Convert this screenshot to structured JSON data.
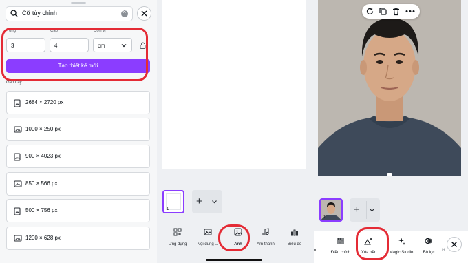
{
  "left_panel": {
    "search": {
      "value": "Cỡ tùy chỉnh"
    },
    "width_label": "rộng",
    "height_label": "Cao",
    "unit_label": "Đơn vị",
    "width_value": "3",
    "height_value": "4",
    "unit_value": "cm",
    "create_button": "Tạo thiết kế mới",
    "recent_label": "Gần đây",
    "recent_sizes": [
      "2684 × 2720 px",
      "1000 × 250 px",
      "900 × 4023 px",
      "850 × 566 px",
      "500 × 756 px",
      "1200 × 628 px"
    ]
  },
  "middle_panel": {
    "page_number": "1",
    "toolbar": [
      "Ứng dụng",
      "Nội dung ...",
      "Ảnh",
      "Âm thanh",
      "Biểu đồ"
    ]
  },
  "right_panel": {
    "page_number": "1",
    "toolbar": [
      "n",
      "Điều chỉnh",
      "Xóa nền",
      "Magic Studio",
      "Bộ lọc",
      "H"
    ]
  },
  "colors": {
    "accent": "#8b3dff",
    "highlight_ring": "#e42b35"
  },
  "icons": [
    "search-icon",
    "clear-icon",
    "close-icon",
    "chevron-down-icon",
    "lock-icon",
    "portrait-size-icon",
    "landscape-size-icon",
    "apps-icon",
    "content-icon",
    "photo-icon",
    "music-icon",
    "chart-icon",
    "refresh-icon",
    "duplicate-icon",
    "trash-icon",
    "more-icon",
    "adjust-icon",
    "background-remover-icon",
    "magic-studio-icon",
    "filter-icon"
  ]
}
